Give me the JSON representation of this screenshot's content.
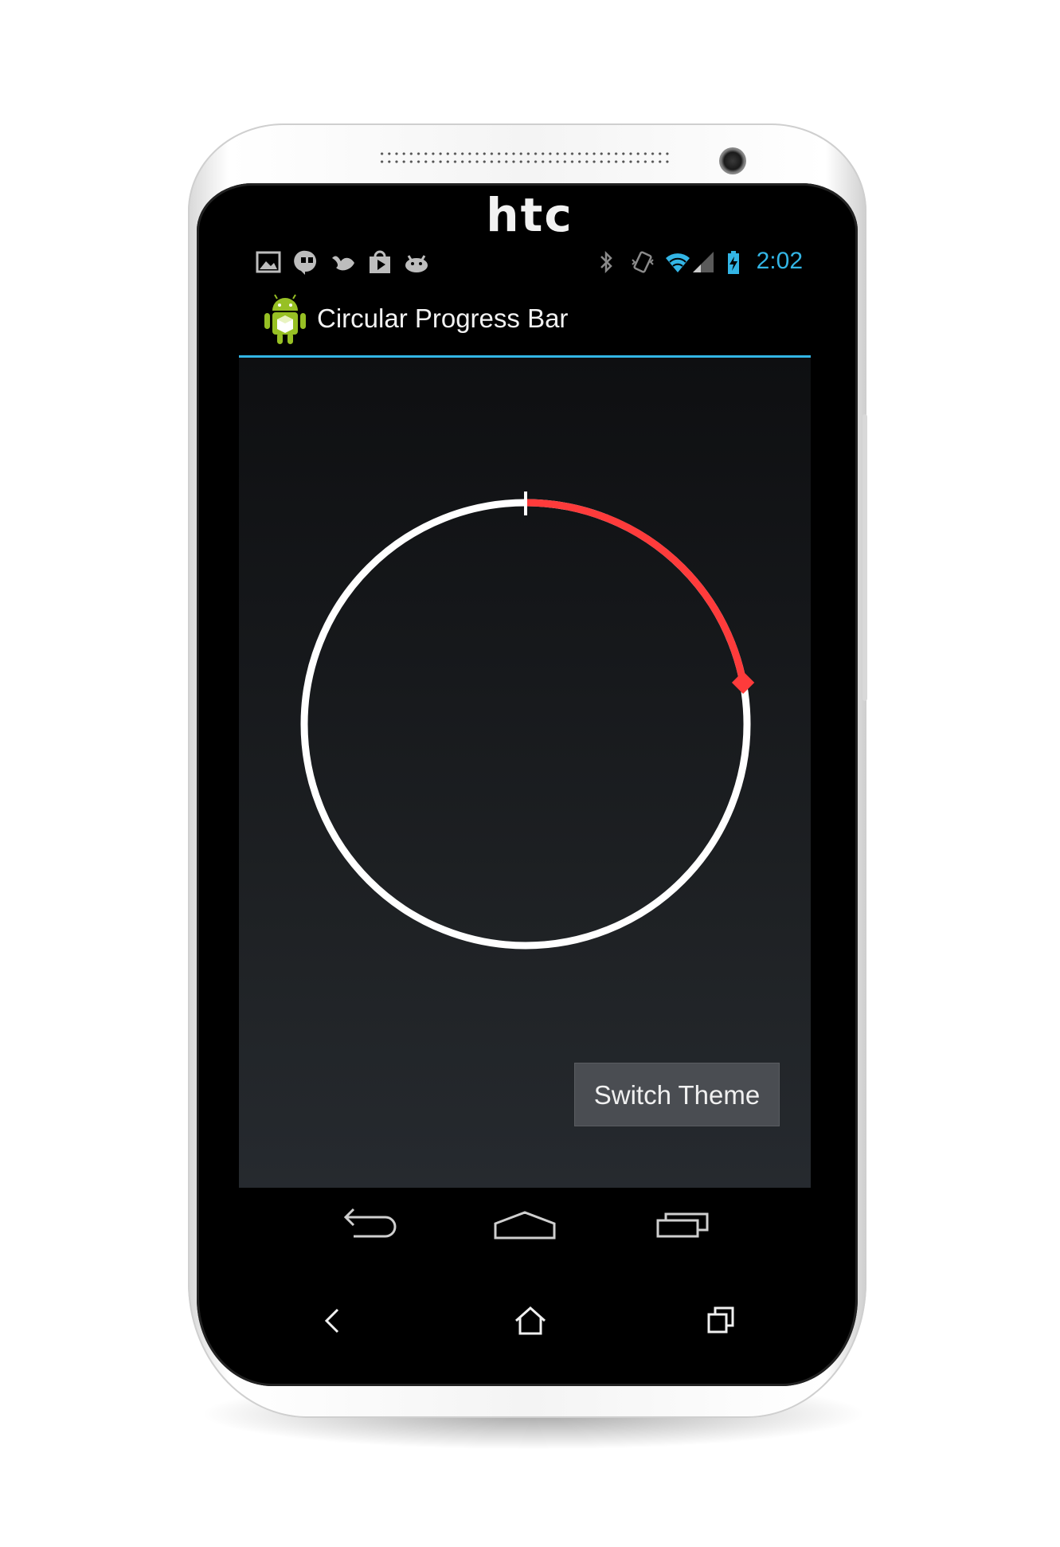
{
  "device": {
    "brand": "htc"
  },
  "status_bar": {
    "time": "2:02",
    "icons_left": [
      "gallery-icon",
      "hangouts-icon",
      "bird-icon",
      "play-store-icon",
      "android-bug-icon"
    ],
    "icons_right": [
      "bluetooth-icon",
      "vibrate-icon",
      "wifi-icon",
      "signal-icon",
      "battery-charging-icon"
    ],
    "accent_color": "#33b5e5"
  },
  "action_bar": {
    "title": "Circular Progress Bar",
    "icon": "android-app-icon",
    "divider_color": "#33b5e5"
  },
  "progress": {
    "value_fraction": 0.22,
    "track_color": "#ffffff",
    "progress_color": "#ff3b3b"
  },
  "main": {
    "switch_theme_label": "Switch Theme"
  },
  "nav_bar": {
    "buttons": [
      "back-icon",
      "home-icon",
      "recent-apps-icon"
    ]
  }
}
